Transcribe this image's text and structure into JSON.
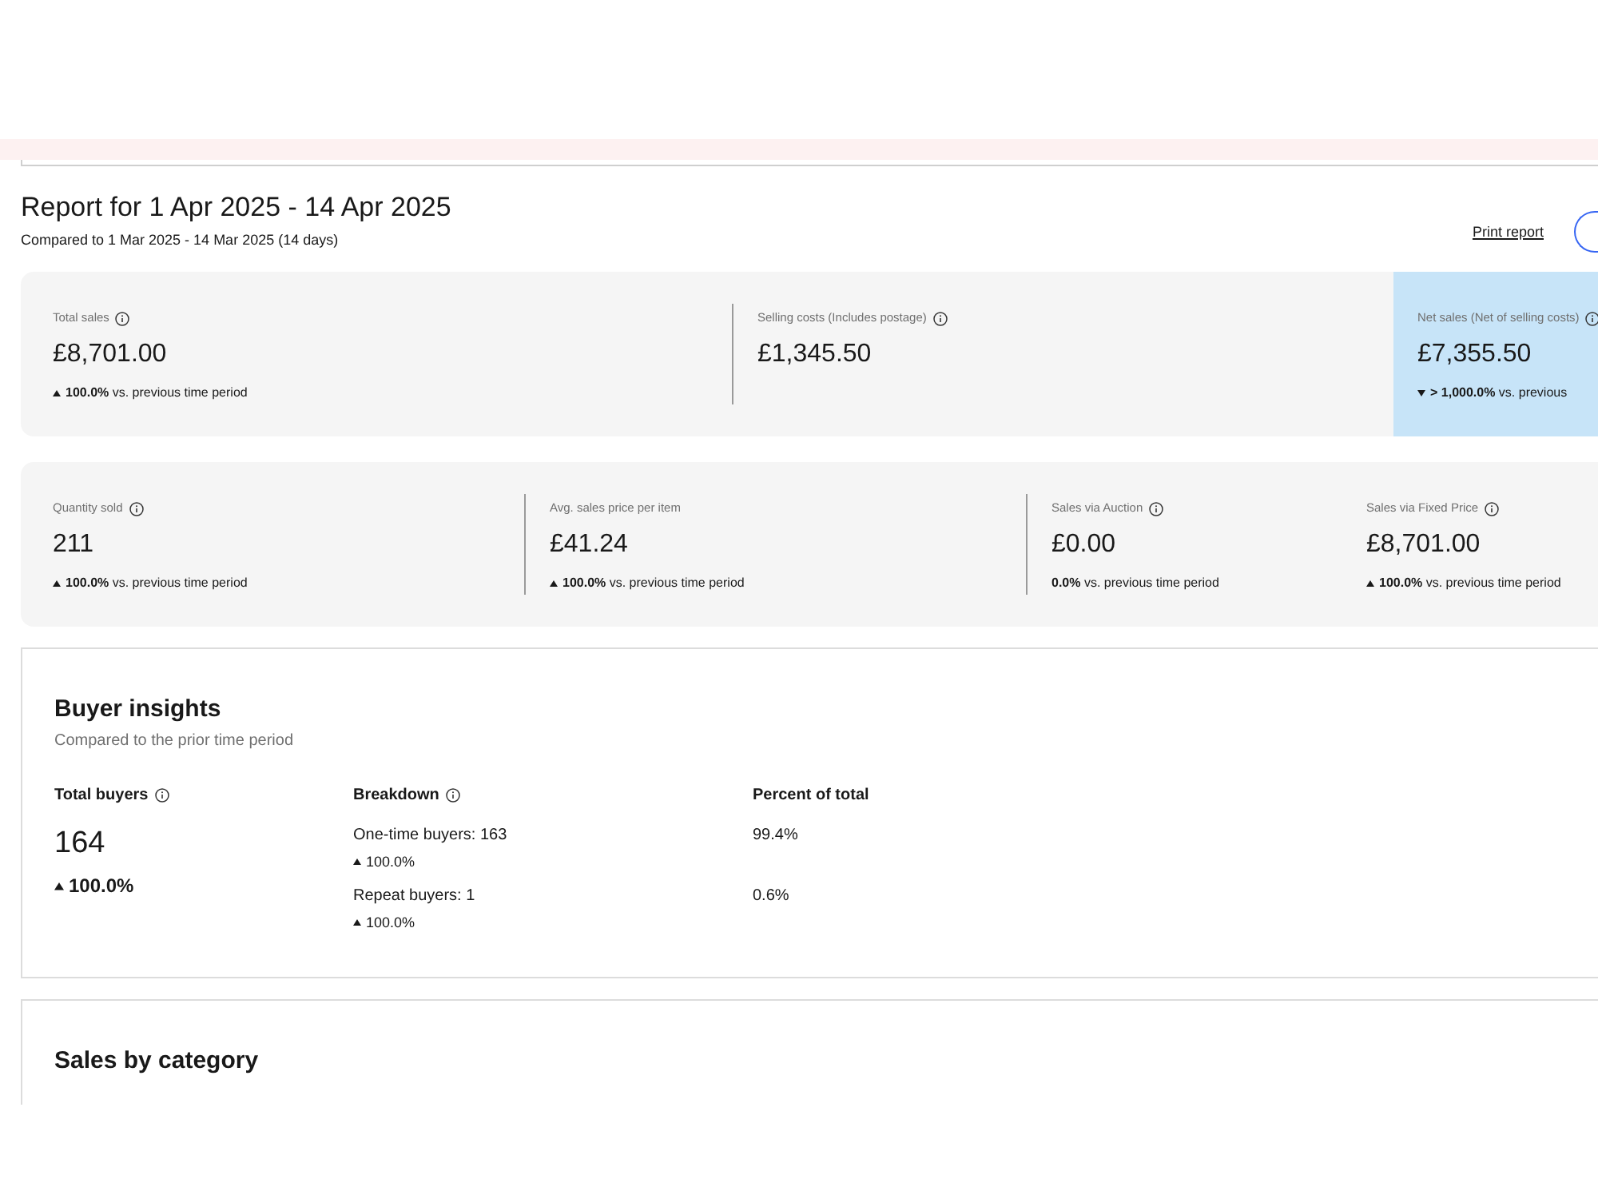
{
  "report": {
    "title": "Report for 1 Apr 2025 - 14 Apr 2025",
    "comparison": "Compared to 1 Mar 2025 - 14 Mar 2025 (14 days)",
    "print_link": "Print report"
  },
  "metric_panels": [
    {
      "metrics": [
        {
          "label": "Total sales",
          "info": true,
          "value": "£8,701.00",
          "change": {
            "kind": "up",
            "text": "**100.0%** vs. previous time period"
          },
          "highlighted": false
        },
        {
          "label": "Selling costs (Includes postage)",
          "info": true,
          "value": "£1,345.50",
          "highlighted": false
        },
        {
          "label": "Net sales (Net of selling costs)",
          "info": true,
          "value": "£7,355.50",
          "change": {
            "kind": "down",
            "text": "**> 1,000.0%** vs. previous"
          },
          "highlighted": true
        }
      ]
    },
    {
      "metrics": [
        {
          "label": "Quantity sold",
          "info": true,
          "value": "211",
          "change": {
            "kind": "up",
            "text": "**100.0%** vs. previous time period"
          },
          "highlighted": false
        },
        {
          "label": "Avg. sales price per item",
          "info": false,
          "value": "£41.24",
          "change": {
            "kind": "up",
            "text": "**100.0%** vs. previous time period"
          },
          "highlighted": false
        },
        {
          "label": "Sales via Auction",
          "info": true,
          "value": "£0.00",
          "change": {
            "kind": "flat",
            "text": "**0.0%** vs. previous time period"
          },
          "highlighted": false
        },
        {
          "label": "Sales via Fixed Price",
          "info": true,
          "value": "£8,701.00",
          "change": {
            "kind": "up",
            "text": "**100.0%** vs. previous time period"
          },
          "highlighted": false
        }
      ]
    }
  ],
  "buyer_insights": {
    "title": "Buyer insights",
    "subtitle": "Compared to the prior time period",
    "columns": [
      {
        "heading": "Total buyers",
        "info": true
      },
      {
        "heading": "Breakdown",
        "info": true
      },
      {
        "heading": "Percent of total",
        "info": false
      }
    ],
    "total": {
      "value": "164",
      "change": {
        "kind": "up",
        "text": "100.0%"
      }
    },
    "rows": [
      {
        "label": "One-time buyers: 163",
        "change": {
          "kind": "up",
          "text": "100.0%"
        },
        "percent": "99.4%"
      },
      {
        "label": "Repeat buyers: 1",
        "change": {
          "kind": "up",
          "text": "100.0%"
        },
        "percent": "0.6%"
      }
    ]
  },
  "sales_by_category": {
    "title": "Sales by category"
  }
}
